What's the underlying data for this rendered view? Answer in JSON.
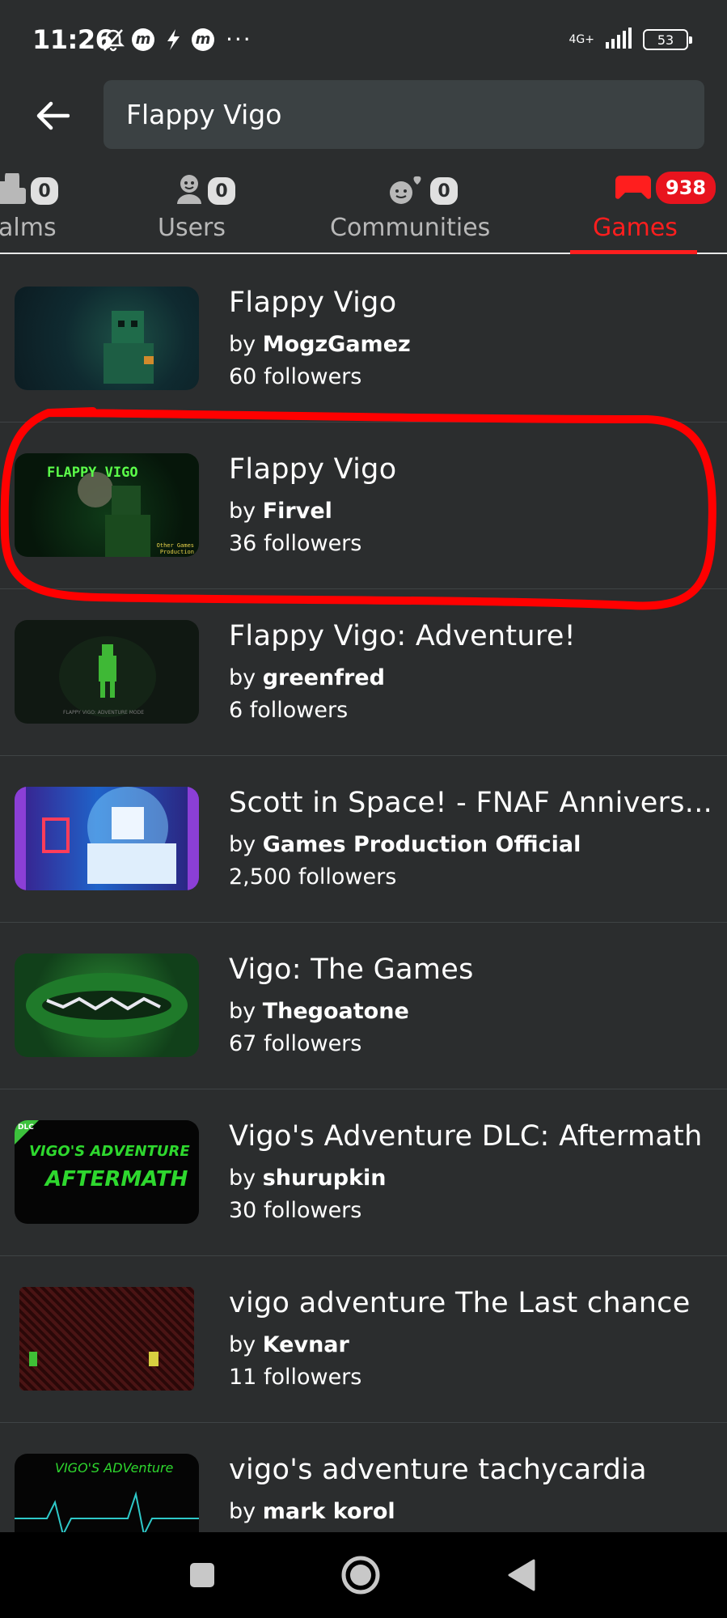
{
  "status_bar": {
    "time": "11:26",
    "more": "···",
    "network": "4G+",
    "battery": "53"
  },
  "search": {
    "query": "Flappy Vigo"
  },
  "tabs": [
    {
      "label": "alms",
      "count": "0",
      "icon": "realm-icon"
    },
    {
      "label": "Users",
      "count": "0",
      "icon": "user-icon"
    },
    {
      "label": "Communities",
      "count": "0",
      "icon": "community-icon"
    },
    {
      "label": "Games",
      "count": "938",
      "icon": "gamepad-icon",
      "active": true
    }
  ],
  "results": [
    {
      "title": "Flappy Vigo",
      "by": "by",
      "author": "MogzGamez",
      "followers": "60 followers"
    },
    {
      "title": "Flappy Vigo",
      "by": "by",
      "author": "Firvel",
      "followers": "36 followers",
      "thumb_text": "FLAPPY VIGO",
      "thumb_sub": "Other Games Production"
    },
    {
      "title": "Flappy Vigo: Adventure!",
      "by": "by",
      "author": "greenfred",
      "followers": "6 followers",
      "thumb_text": "FLAPPY VIGO: ADVENTURE MODE"
    },
    {
      "title": "Scott in Space! - FNAF Annivers...",
      "by": "by",
      "author": "Games Production Official",
      "followers": "2,500 followers"
    },
    {
      "title": "Vigo: The Games",
      "by": "by",
      "author": "Thegoatone",
      "followers": "67 followers"
    },
    {
      "title": "Vigo's Adventure DLC: Aftermath",
      "by": "by",
      "author": "shurupkin",
      "followers": "30 followers",
      "thumb_text": "VIGO'S ADVENTURE",
      "thumb_sub": "AFTERMATH",
      "thumb_badge": "DLC"
    },
    {
      "title": "vigo  adventure  The Last chance",
      "by": "by",
      "author": "Kevnar",
      "followers": "11 followers"
    },
    {
      "title": "vigo's adventure tachycardia",
      "by": "by",
      "author": "mark korol",
      "followers": "",
      "thumb_text": "VIGO'S ADVenture"
    }
  ],
  "colors": {
    "background": "#2b2d2e",
    "accent": "#ff1e1e",
    "search_bg": "#3b4143",
    "annotation": "#ff0000"
  }
}
